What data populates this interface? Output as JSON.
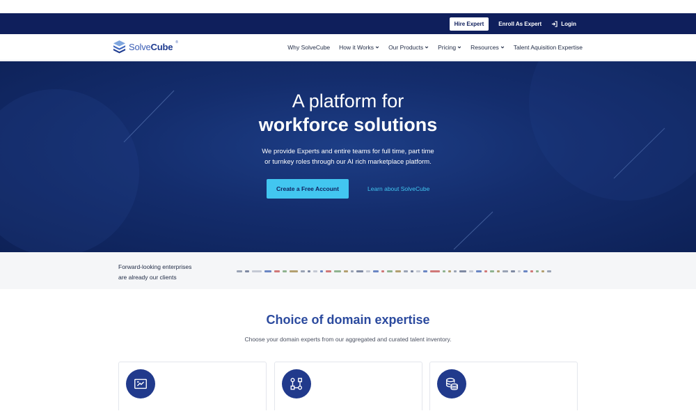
{
  "topbar": {
    "hire_label": "Hire Expert",
    "enroll_label": "Enroll As Expert",
    "login_label": "Login",
    "login_icon": "login-icon"
  },
  "brand": {
    "name_light": "Solve",
    "name_bold": "Cube",
    "reg": "®"
  },
  "nav": {
    "items": [
      {
        "label": "Why SolveCube",
        "dropdown": false
      },
      {
        "label": "How it Works",
        "dropdown": true
      },
      {
        "label": "Our Products",
        "dropdown": true
      },
      {
        "label": "Pricing",
        "dropdown": true
      },
      {
        "label": "Resources",
        "dropdown": true
      },
      {
        "label": "Talent Aquisition Expertise",
        "dropdown": false
      }
    ]
  },
  "hero": {
    "title_line1": "A platform for",
    "title_line2": "workforce solutions",
    "subtitle_line1": "We provide Experts and entire teams for full time, part time",
    "subtitle_line2": "or turnkey roles through our AI rich marketplace platform.",
    "cta_label": "Create a Free Account",
    "learn_label": "Learn about SolveCube"
  },
  "clients": {
    "line1": "Forward-looking enterprises",
    "line2": "are already our clients"
  },
  "domain": {
    "title": "Choice of domain expertise",
    "subtitle": "Choose your domain experts from our aggregated and curated talent inventory.",
    "cards": [
      {
        "icon": "chart-screen-icon"
      },
      {
        "icon": "flow-diagram-icon"
      },
      {
        "icon": "database-coins-icon"
      }
    ]
  },
  "colors": {
    "navy": "#0f1f5c",
    "accent": "#42c6f0",
    "heading_blue": "#2b4a9e"
  }
}
